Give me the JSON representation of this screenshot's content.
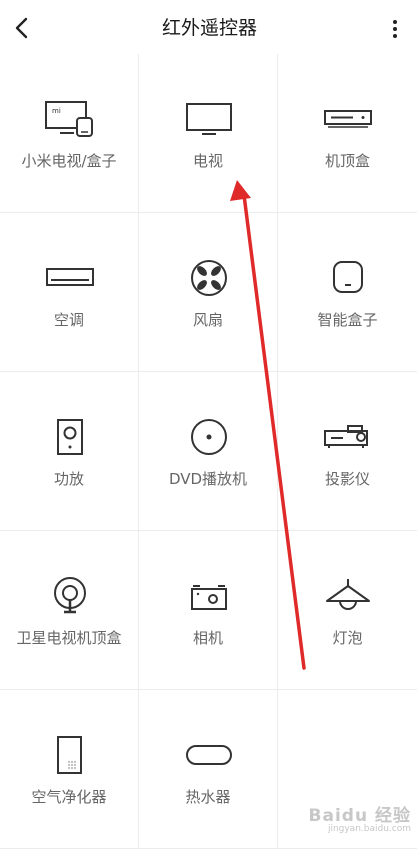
{
  "header": {
    "title": "红外遥控器"
  },
  "devices": [
    {
      "label": "小米电视/盒子",
      "icon": "mi-tv-box-icon"
    },
    {
      "label": "电视",
      "icon": "tv-icon"
    },
    {
      "label": "机顶盒",
      "icon": "set-top-box-icon"
    },
    {
      "label": "空调",
      "icon": "air-conditioner-icon"
    },
    {
      "label": "风扇",
      "icon": "fan-icon"
    },
    {
      "label": "智能盒子",
      "icon": "smart-box-icon"
    },
    {
      "label": "功放",
      "icon": "speaker-icon"
    },
    {
      "label": "DVD播放机",
      "icon": "disc-icon"
    },
    {
      "label": "投影仪",
      "icon": "projector-icon"
    },
    {
      "label": "卫星电视机顶盒",
      "icon": "satellite-dish-icon"
    },
    {
      "label": "相机",
      "icon": "camera-icon"
    },
    {
      "label": "灯泡",
      "icon": "lamp-icon"
    },
    {
      "label": "空气净化器",
      "icon": "air-purifier-icon"
    },
    {
      "label": "热水器",
      "icon": "water-heater-icon"
    }
  ],
  "annotation": {
    "arrow_color": "#e02a2a"
  },
  "watermark": {
    "logo": "Baidu 经验",
    "url": "jingyan.baidu.com"
  }
}
